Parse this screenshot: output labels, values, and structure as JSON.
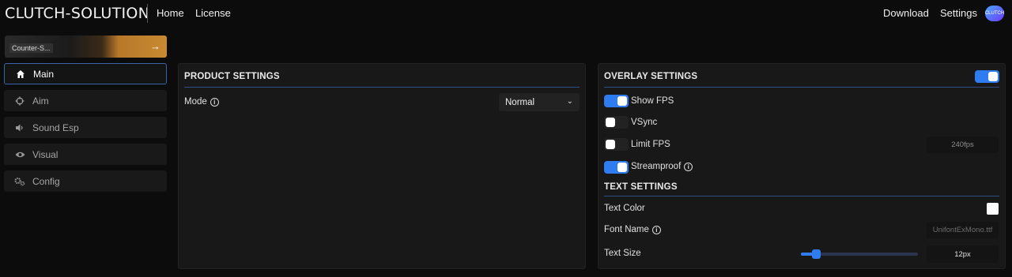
{
  "header": {
    "logo": "CLUTCH-SOLUTION",
    "nav_left": [
      "Home",
      "License"
    ],
    "nav_right": [
      "Download",
      "Settings"
    ],
    "avatar_text": "CLUTCH"
  },
  "banner": {
    "label": "Counter-S...",
    "arrow": "→"
  },
  "sidebar": {
    "items": [
      {
        "label": "Main",
        "icon": "home-icon",
        "active": true
      },
      {
        "label": "Aim",
        "icon": "crosshair-icon",
        "active": false
      },
      {
        "label": "Sound Esp",
        "icon": "speaker-icon",
        "active": false
      },
      {
        "label": "Visual",
        "icon": "eye-icon",
        "active": false
      },
      {
        "label": "Config",
        "icon": "gears-icon",
        "active": false
      }
    ]
  },
  "product_settings": {
    "title": "PRODUCT SETTINGS",
    "mode_label": "Mode",
    "mode_value": "Normal"
  },
  "overlay_settings": {
    "title": "OVERLAY SETTINGS",
    "enabled": true,
    "show_fps": {
      "label": "Show FPS",
      "checked": true
    },
    "vsync": {
      "label": "VSync",
      "checked": false
    },
    "limit_fps": {
      "label": "Limit FPS",
      "checked": false,
      "value": "240fps"
    },
    "streamproof": {
      "label": "Streamproof",
      "checked": true
    }
  },
  "text_settings": {
    "title": "TEXT SETTINGS",
    "text_color_label": "Text Color",
    "text_color_value": "#ffffff",
    "font_name_label": "Font Name",
    "font_name_value": "UnifontExMono.ttf",
    "text_size_label": "Text Size",
    "text_size_value": "12px",
    "text_size_fraction": 0.13
  },
  "colors": {
    "accent": "#2f7cf0",
    "rule": "#2d4f85",
    "panel": "#181818",
    "background": "#0c0c0c"
  }
}
